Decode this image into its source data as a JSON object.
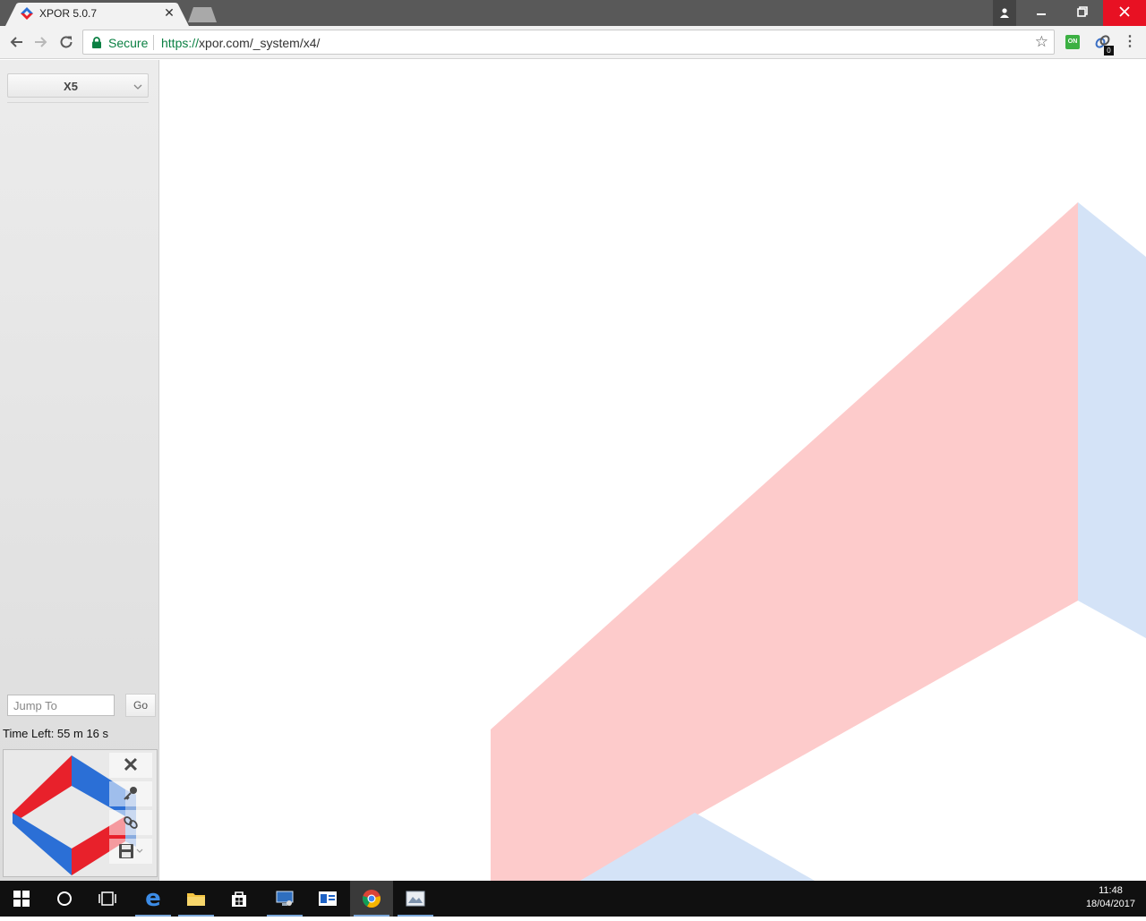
{
  "browser": {
    "tab_title": "XPOR 5.0.7",
    "secure_label": "Secure",
    "url_scheme": "https://",
    "url_rest": "xpor.com/_system/x4/",
    "extension_on_label": "ON",
    "extension_badge": "0"
  },
  "sidebar": {
    "view_select_value": "X5",
    "jump_placeholder": "Jump To",
    "go_label": "Go",
    "time_left": "Time Left: 55 m 16 s"
  },
  "taskbar": {
    "time": "11:48",
    "date": "18/04/2017"
  },
  "colors": {
    "logo_red": "#e8212b",
    "logo_blue": "#2b6fd6",
    "canvas_red": "#fdcbcb",
    "canvas_blue": "#d4e3f7"
  }
}
